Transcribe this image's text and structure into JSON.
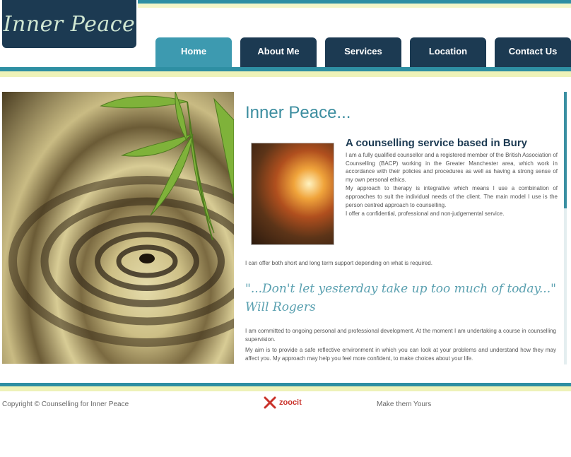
{
  "header": {
    "logo_text": "Inner Peace"
  },
  "nav": {
    "tabs": [
      {
        "label": "Home",
        "active": true
      },
      {
        "label": "About Me",
        "active": false
      },
      {
        "label": "Services",
        "active": false
      },
      {
        "label": "Location",
        "active": false
      },
      {
        "label": "Contact Us",
        "active": false
      }
    ]
  },
  "main": {
    "title": "Inner Peace...",
    "heading": "A counselling service based in Bury",
    "paragraphs": [
      "I am a fully qualified counsellor and a registered member of the British Association of Counselling (BACP) working in the Greater Manchester area, which work in accordance with their policies and procedures as well as having a strong sense of my own personal ethics.",
      "My approach to therapy is integrative which means I use a combination of approaches to suit the individual needs of the client. The main model I use is the person centred approach to counselling.",
      "I offer a confidential, professional and non-judgemental service."
    ],
    "paragraph_wide": "I can offer both short and long term support depending on what is required.",
    "quote": "\"...Don't let yesterday take up too much of today...\" Will Rogers",
    "after_paragraphs": [
      "I am committed to ongoing personal and professional development. At the moment I am undertaking a course in counselling supervision.",
      "My aim is to provide a safe reflective environment in which you can look at your problems and understand how they may affect you. My approach may help you feel more confident, to make choices about your life."
    ]
  },
  "footer": {
    "copyright": "Copyright © Counselling for Inner Peace",
    "badge_label": "zoocit",
    "link_text": "Make them Yours"
  },
  "colors": {
    "navy": "#1c3a52",
    "teal": "#2e8fa3",
    "active_tab": "#3d9ab0",
    "pale_yellow": "#eef2b8",
    "title_teal": "#3d8ea0"
  }
}
